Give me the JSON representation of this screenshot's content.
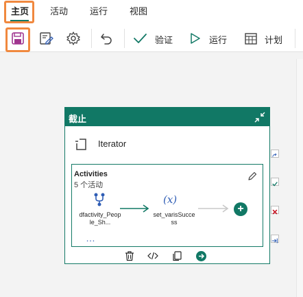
{
  "menu": {
    "tabs": [
      {
        "label": "主页",
        "active": true
      },
      {
        "label": "活动",
        "active": false
      },
      {
        "label": "运行",
        "active": false
      },
      {
        "label": "视图",
        "active": false
      }
    ]
  },
  "toolbar": {
    "save_icon": "save-icon",
    "save_as_template_icon": "save-as-template-icon",
    "settings_icon": "gear-icon",
    "undo_icon": "undo-icon",
    "validate_label": "验证",
    "run_label": "运行",
    "schedule_label": "计划"
  },
  "card": {
    "title": "截止",
    "iterator_label": "Iterator",
    "inner": {
      "title": "Activities",
      "subtitle": "5 个活动",
      "nodes": [
        {
          "icon": "dataflow-icon",
          "label": "dfactivity_People_Sh..."
        },
        {
          "icon": "variable-icon",
          "glyph": "(x)",
          "label": "set_varisSuccess"
        }
      ],
      "add_label": "+",
      "more_label": "…"
    }
  },
  "colors": {
    "accent": "#117865",
    "highlight": "#f0883e",
    "save_icon": "#a0358f",
    "link_blue": "#2f5db5"
  }
}
